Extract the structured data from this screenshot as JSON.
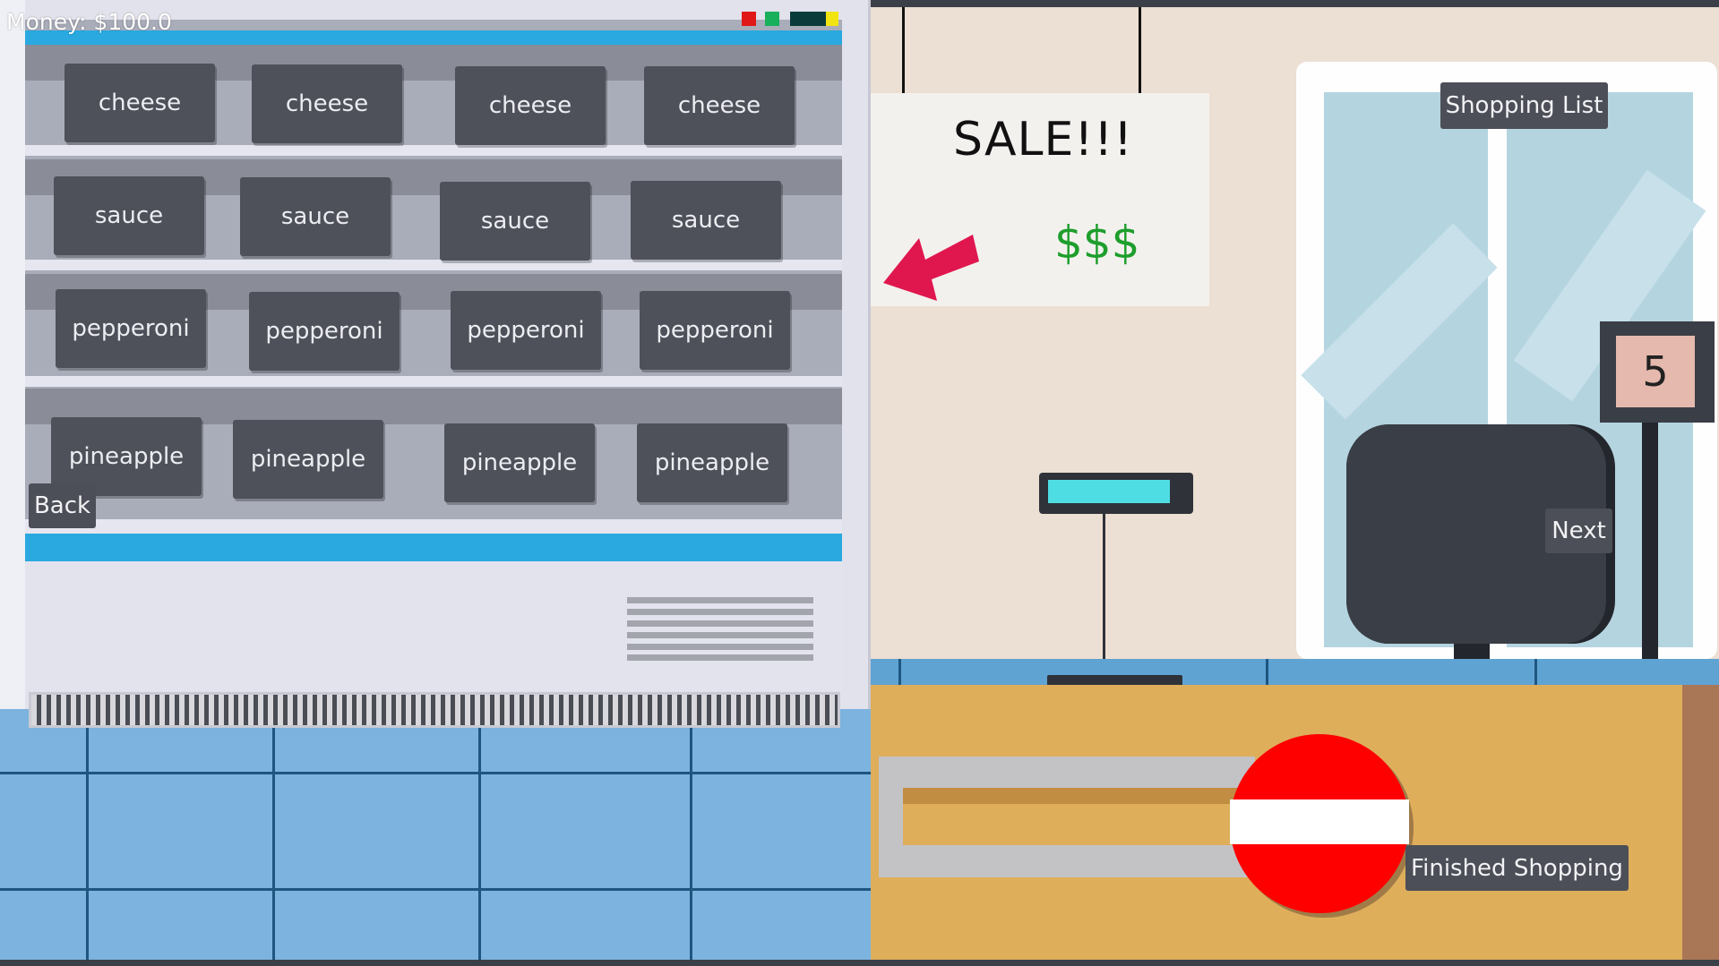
{
  "hud": {
    "money": "Money: $100.0"
  },
  "shelves": [
    {
      "row": "cheese",
      "items": [
        "cheese",
        "cheese",
        "cheese",
        "cheese"
      ]
    },
    {
      "row": "sauce",
      "items": [
        "sauce",
        "sauce",
        "sauce",
        "sauce"
      ]
    },
    {
      "row": "pepperoni",
      "items": [
        "pepperoni",
        "pepperoni",
        "pepperoni",
        "pepperoni"
      ]
    },
    {
      "row": "pineapple",
      "items": [
        "pineapple",
        "pineapple",
        "pineapple",
        "pineapple"
      ]
    }
  ],
  "nav": {
    "back": "Back",
    "next": "Next",
    "shopping_list": "Shopping List",
    "finished": "Finished Shopping"
  },
  "sign": {
    "title": "SALE!!!",
    "price": "$$$"
  },
  "counter_display": {
    "number": "5"
  },
  "colors": {
    "accent_blue": "#29a9e0",
    "button_dark": "#4e5159",
    "price_green": "#1e9e2c",
    "arrow_red": "#e0174f",
    "stop_red": "#fe0000"
  }
}
